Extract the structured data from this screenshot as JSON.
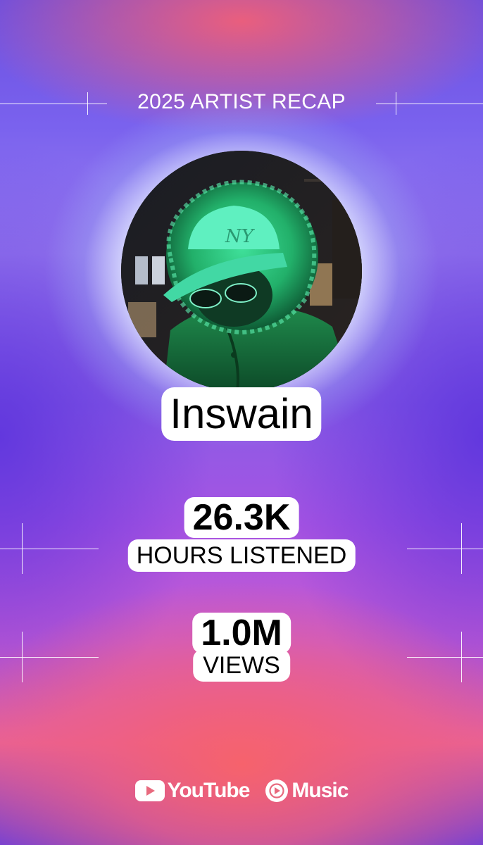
{
  "header": {
    "title": "2025 ARTIST RECAP"
  },
  "artist": {
    "name": "Inswain",
    "avatar_icon": "artist-photo"
  },
  "stats": [
    {
      "value": "26.3K",
      "label": "HOURS LISTENED"
    },
    {
      "value": "1.0M",
      "label": "VIEWS"
    }
  ],
  "footer": {
    "youtube_label": "YouTube",
    "music_label": "Music",
    "youtube_icon": "youtube-play-icon",
    "music_icon": "youtube-music-icon"
  },
  "colors": {
    "accent_white": "#ffffff",
    "text_black": "#000000",
    "gradient_pink": "#f6626c",
    "gradient_purple": "#7a62ee"
  }
}
